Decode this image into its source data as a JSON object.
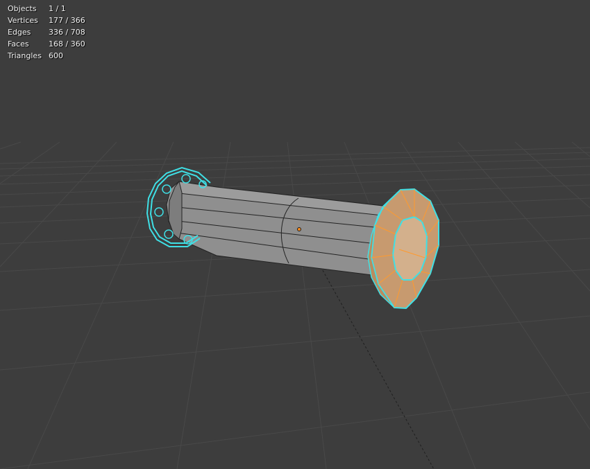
{
  "stats": {
    "objects": {
      "label": "Objects",
      "value": "1 / 1"
    },
    "vertices": {
      "label": "Vertices",
      "value": "177 / 366"
    },
    "edges": {
      "label": "Edges",
      "value": "336 / 708"
    },
    "faces": {
      "label": "Faces",
      "value": "168 / 360"
    },
    "triangles": {
      "label": "Triangles",
      "value": "600"
    }
  },
  "colors": {
    "background": "#3d3d3d",
    "grid": "#4a4a4a",
    "mesh_body": "#8c8c8c",
    "selected_face": "#c99a70",
    "selected_edge": "#ff9a2e",
    "active_outline": "#3fe0e6",
    "origin_dot": "#ff8c1a"
  }
}
